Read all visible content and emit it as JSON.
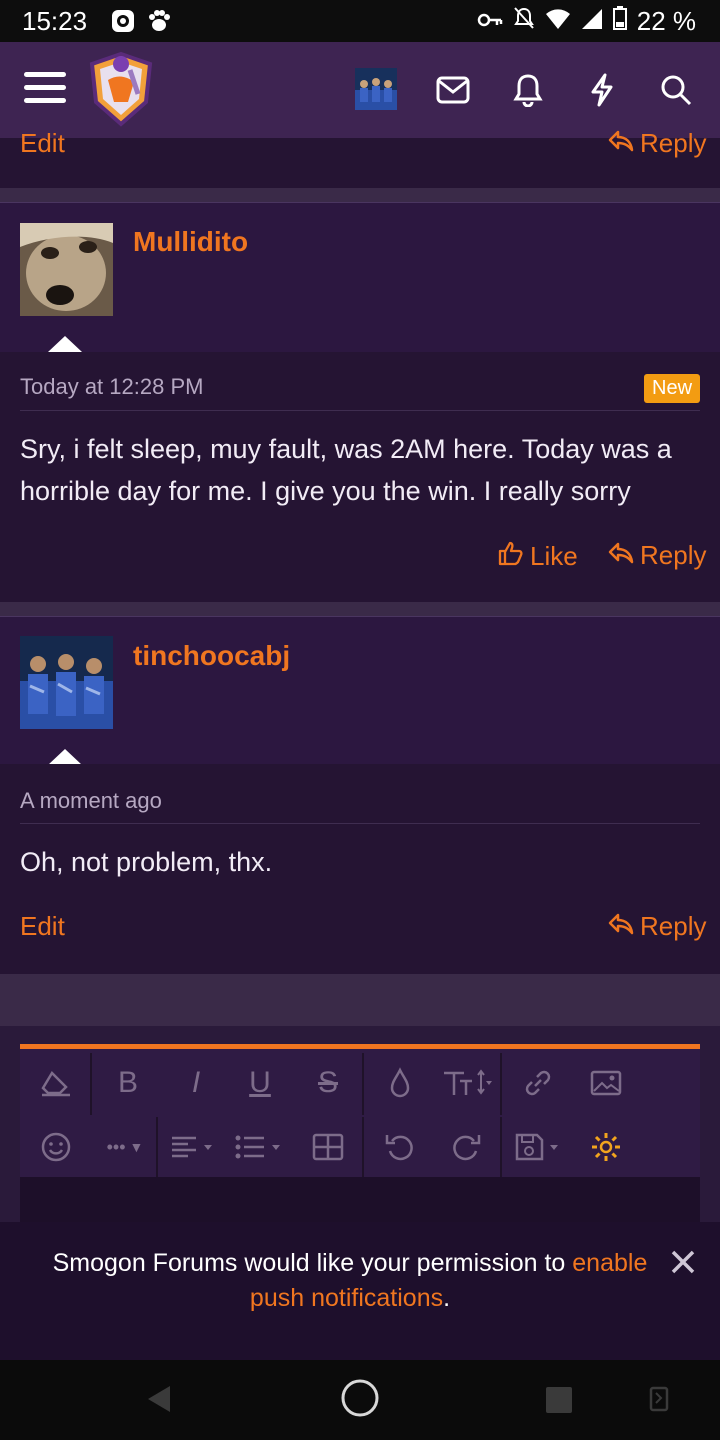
{
  "status_bar": {
    "time": "15:23",
    "battery": "22 %"
  },
  "previous_post_actions": {
    "edit": "Edit",
    "reply": "Reply"
  },
  "posts": [
    {
      "username": "Mullidito",
      "date": "Today at 12:28 PM",
      "badge": "New",
      "message": "Sry, i felt sleep, muy fault, was 2AM here. Today was a horrible day for me. I give you the win. I really sorry",
      "actions": {
        "like": "Like",
        "reply": "Reply"
      }
    },
    {
      "username": "tinchoocabj",
      "date": "A moment ago",
      "message": "Oh, not problem, thx.",
      "actions": {
        "edit": "Edit",
        "reply": "Reply"
      }
    }
  ],
  "editor_toolbar": {
    "icons": [
      "eraser-icon",
      "bold-icon",
      "italic-icon",
      "underline-icon",
      "strikethrough-icon",
      "color-icon",
      "font-size-icon",
      "link-icon",
      "image-icon",
      "smiley-icon",
      "more-icon",
      "align-icon",
      "list-icon",
      "table-icon",
      "undo-icon",
      "redo-icon",
      "save-draft-icon",
      "settings-icon"
    ],
    "labels": {
      "bold": "B",
      "italic": "I",
      "underline": "U",
      "strike": "S",
      "more": "•••"
    }
  },
  "notification": {
    "text_before": "Smogon Forums would like your permission to ",
    "link_text": "enable push notifications",
    "text_after": "."
  },
  "colors": {
    "accent": "#f07620",
    "header": "#3e2452",
    "post_bg": "#2c1740",
    "badge": "#f39c12"
  }
}
